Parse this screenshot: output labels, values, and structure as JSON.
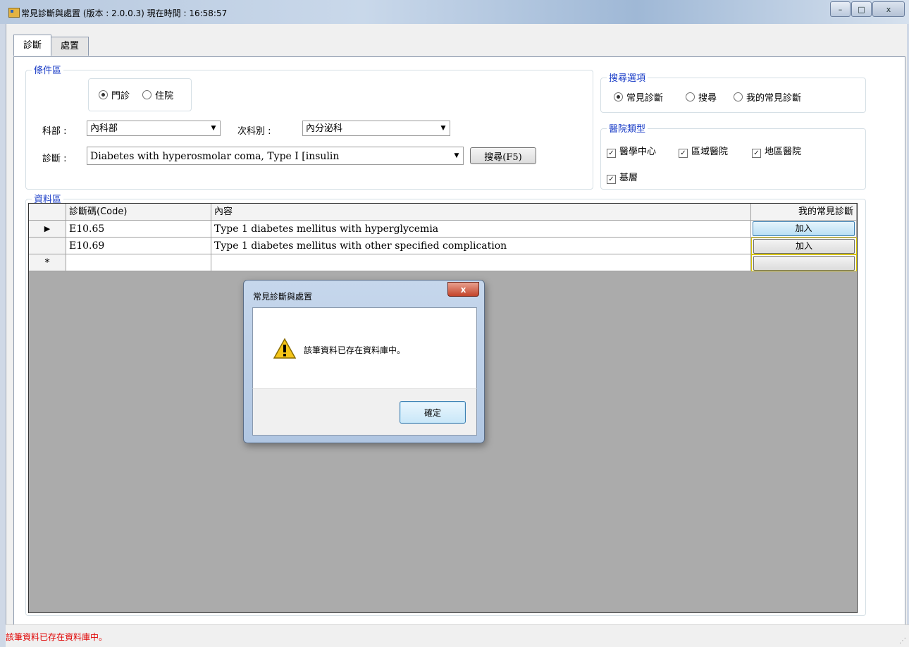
{
  "window": {
    "title": "常見診斷與處置 (版本 : 2.0.0.3)  現在時間 : 16:58:57",
    "minimize": "–",
    "maximize": "□",
    "close": "x"
  },
  "tabs": [
    {
      "label": "診斷"
    },
    {
      "label": "處置"
    }
  ],
  "conditions": {
    "legend": "條件區",
    "radio_outpatient": "門診",
    "radio_inpatient": "住院",
    "selected": "門診",
    "dept_label": "科部 :",
    "dept_value": "內科部",
    "subdept_label": "次科別 :",
    "subdept_value": "內分泌科",
    "diag_label": "診斷 :",
    "diag_value": "Diabetes with hyperosmolar coma, Type I [insulin",
    "search_button": "搜尋(F5)"
  },
  "search_options": {
    "legend": "搜尋選項",
    "opt1": "常見診斷",
    "opt2": "搜尋",
    "opt3": "我的常見診斷",
    "selected": "常見診斷"
  },
  "hospital_type": {
    "legend": "醫院類型",
    "opt1": "醫學中心",
    "opt2": "區域醫院",
    "opt3": "地區醫院",
    "opt4": "基層"
  },
  "data_area": {
    "legend": "資料區",
    "columns": {
      "code": "診斷碼(Code)",
      "content": "內容",
      "mine": "我的常見診斷"
    },
    "rows": [
      {
        "marker": "▶",
        "code": "E10.65",
        "content": "Type 1 diabetes mellitus with hyperglycemia",
        "button": "加入"
      },
      {
        "marker": "",
        "code": "E10.69",
        "content": "Type 1 diabetes mellitus with other specified complication",
        "button": "加入"
      }
    ],
    "new_row_marker": "*"
  },
  "dialog": {
    "title": "常見診斷與處置",
    "message": "該筆資料已存在資料庫中。",
    "ok": "確定",
    "close": "x"
  },
  "status_bar": {
    "message": "該筆資料已存在資料庫中。"
  }
}
